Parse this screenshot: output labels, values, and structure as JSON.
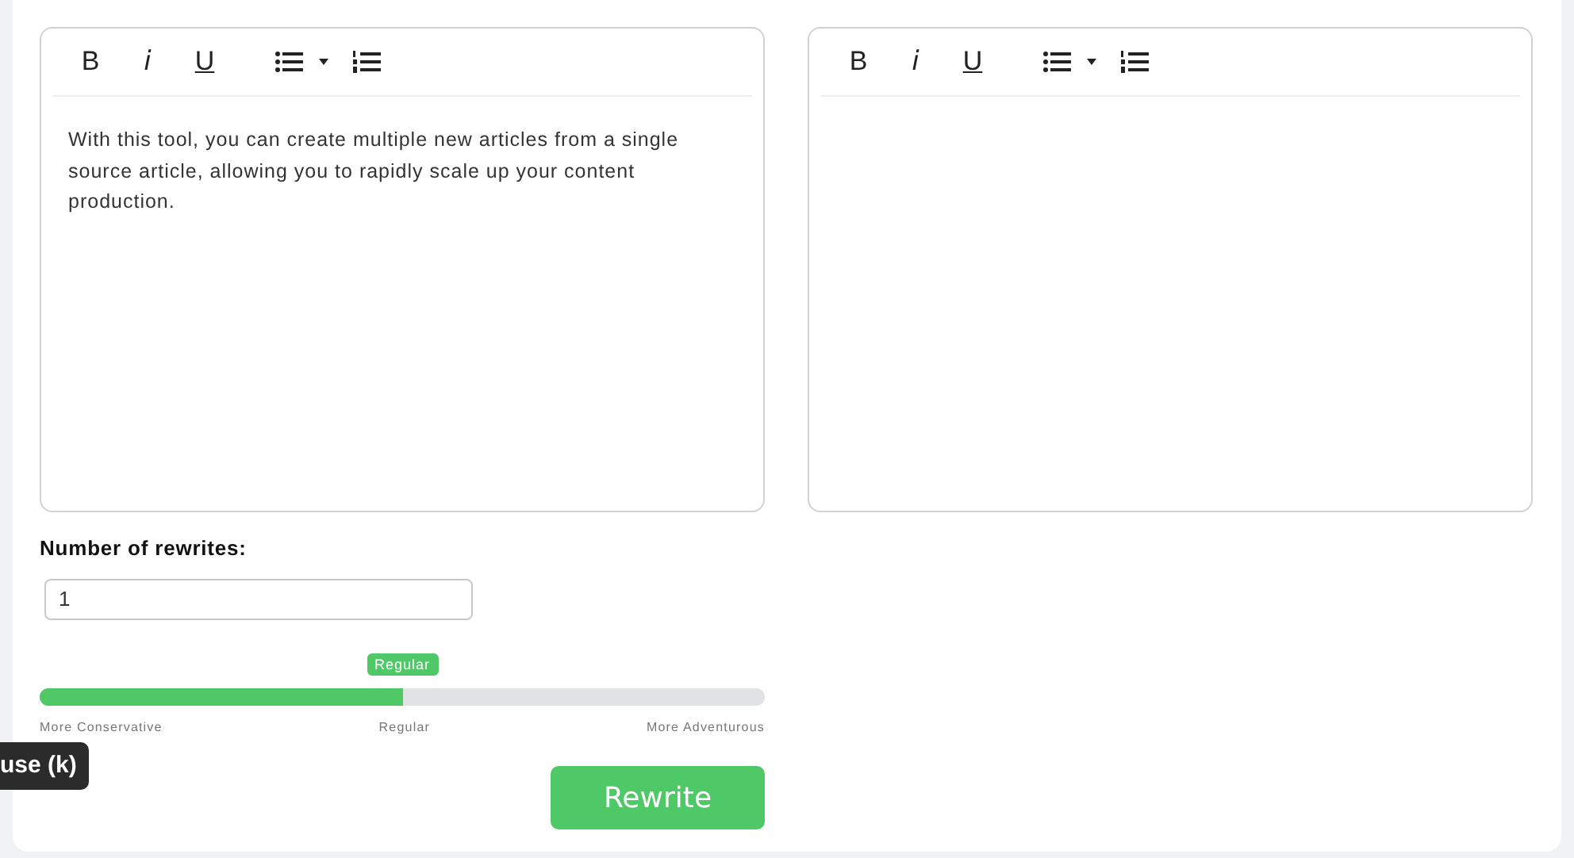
{
  "editors": [
    {
      "toolbar": [
        "B",
        "i",
        "U"
      ],
      "text": "With this tool, you can create multiple new articles from a single source article, allowing you to rapidly scale up your content production."
    },
    {
      "toolbar": [
        "B",
        "i",
        "U"
      ]
    }
  ],
  "rewrites": {
    "label": "Number of rewrites:",
    "value": "1"
  },
  "creativity": {
    "level": 0.5,
    "bubble": "Regular",
    "labels": [
      "More Conservative",
      "Regular",
      "More Adventurous"
    ]
  },
  "button": "Rewrite",
  "tooltip": "use (k)"
}
